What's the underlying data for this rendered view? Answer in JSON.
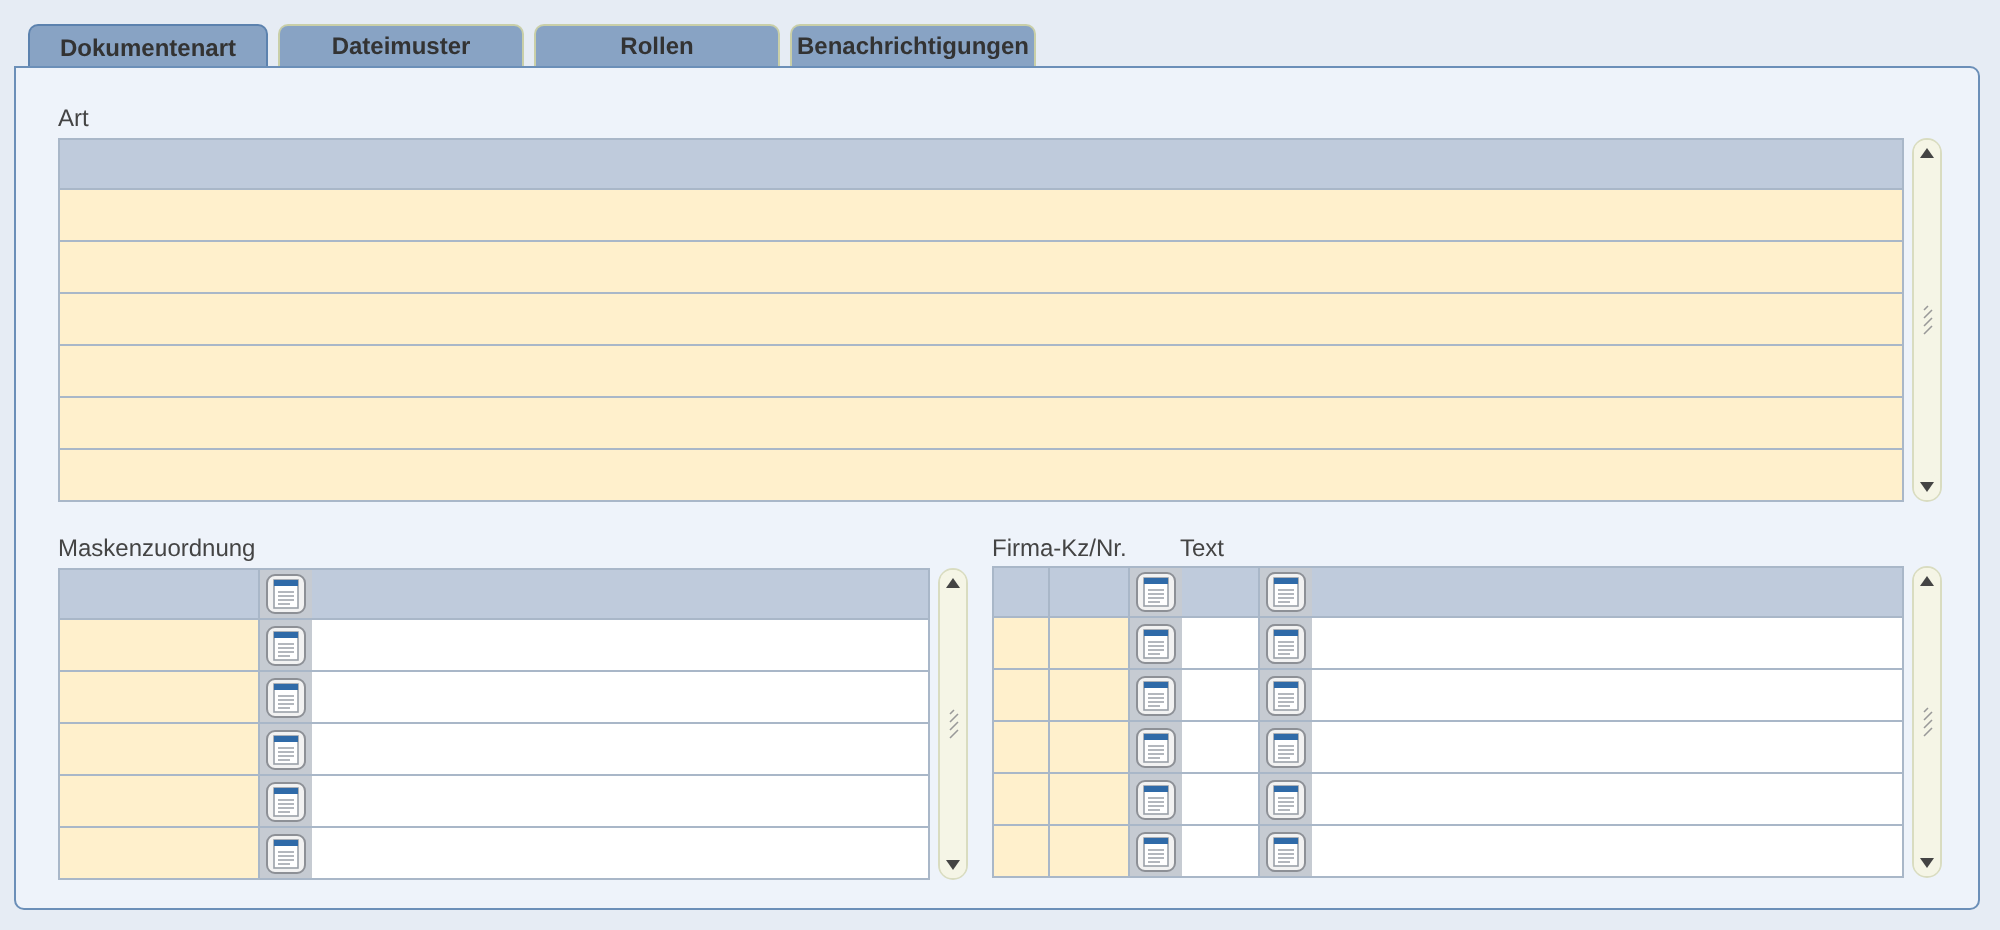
{
  "tabs": [
    {
      "label": "Dokumentenart",
      "selected": true
    },
    {
      "label": "Dateimuster",
      "selected": false
    },
    {
      "label": "Rollen",
      "selected": false
    },
    {
      "label": "Benachrichtigungen",
      "selected": false
    }
  ],
  "grids": [
    {
      "title": "Art",
      "columns": [
        {
          "kind": "field",
          "required": true
        }
      ]
    },
    {
      "title": "Maskenzuordnung",
      "columns": [
        {
          "kind": "field",
          "required": true
        },
        {
          "kind": "button"
        },
        {
          "kind": "field",
          "required": false
        }
      ]
    },
    {
      "columns": [
        {
          "kind": "field",
          "required": true,
          "label": "Firma-Kz/Nr."
        },
        {
          "kind": "field",
          "required": true
        },
        {
          "kind": "button"
        },
        {
          "kind": "field",
          "required": false,
          "label": "Text"
        },
        {
          "kind": "button"
        },
        {
          "kind": "field",
          "required": false
        }
      ]
    }
  ]
}
